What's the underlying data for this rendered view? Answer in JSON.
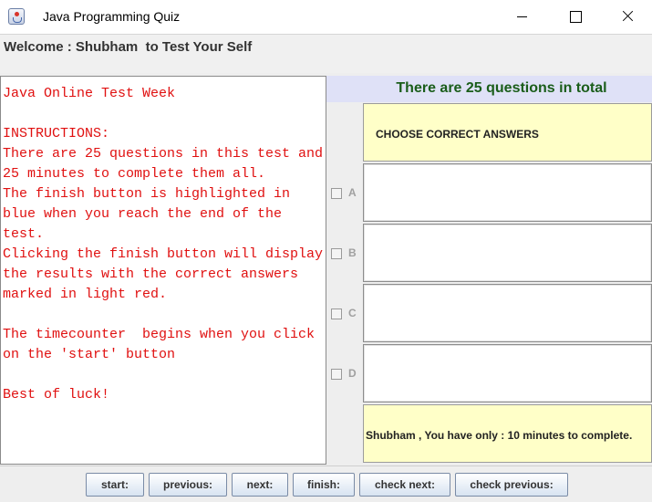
{
  "window": {
    "title": "Java Programming Quiz"
  },
  "header": {
    "welcome": "Welcome : Shubham  to Test Your Self"
  },
  "instructions": {
    "text": "Java Online Test Week\n\nINSTRUCTIONS:\nThere are 25 questions in this test and 25 minutes to complete them all.\nThe finish button is highlighted in blue when you reach the end of the test.\nClicking the finish button will display the results with the correct answers marked in light red.\n\nThe timecounter  begins when you click on the 'start' button\n\nBest of luck!"
  },
  "quiz": {
    "count_text": "There are 25 questions in total",
    "question": "CHOOSE CORRECT ANSWERS",
    "options": [
      {
        "label": "A",
        "answer": ""
      },
      {
        "label": "B",
        "answer": ""
      },
      {
        "label": "C",
        "answer": ""
      },
      {
        "label": "D",
        "answer": ""
      }
    ],
    "timer": "Shubham , You have only : 10 minutes to complete."
  },
  "buttons": {
    "start": "start:",
    "previous": "previous:",
    "next": "next:",
    "finish": "finish:",
    "check_next": "check next:",
    "check_previous": "check previous:"
  },
  "colors": {
    "instruction_text": "#e01010",
    "count_text": "#1a5d1a",
    "count_bar": "#dfe1f7",
    "question_bg": "#ffffc8"
  }
}
